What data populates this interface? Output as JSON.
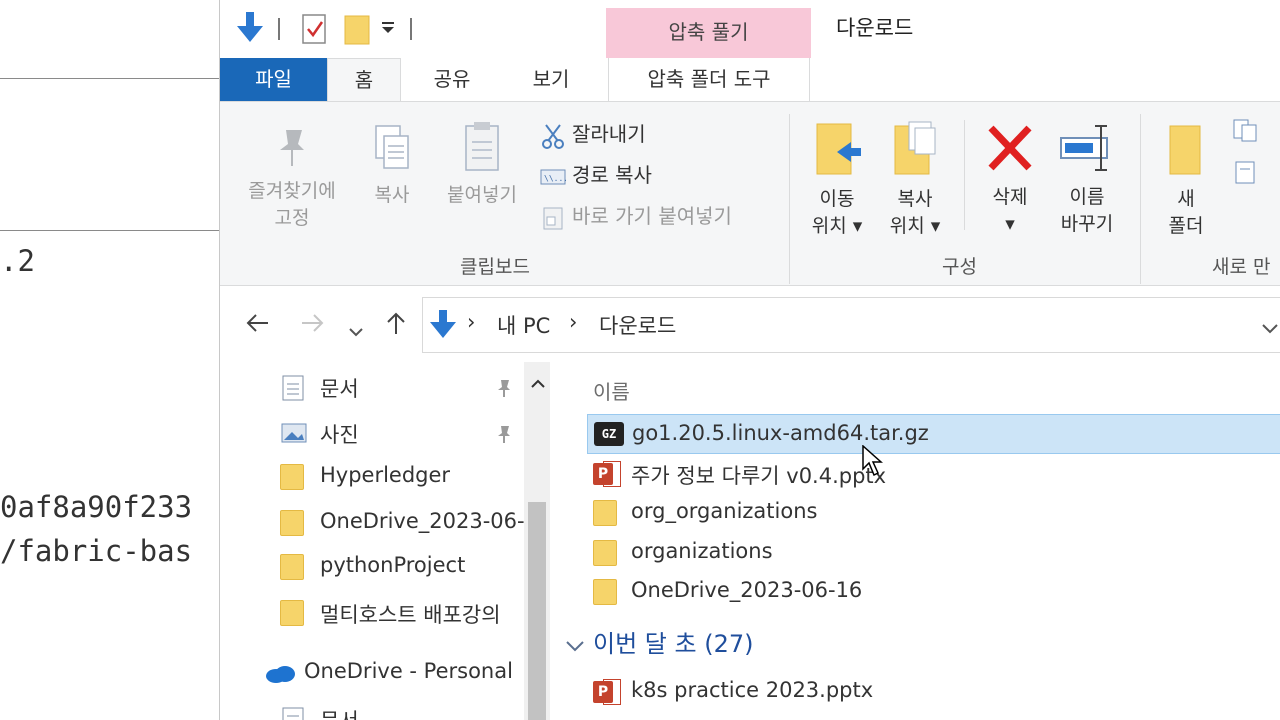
{
  "background_terminal": {
    "lines": [
      ".2",
      "0af8a90f233",
      "/fabric-bas"
    ]
  },
  "titlebar": {
    "contextual_tab_group": "압축 풀기",
    "window_title": "다운로드"
  },
  "tabs": {
    "file": "파일",
    "home": "홈",
    "share": "공유",
    "view": "보기",
    "compressed_tools": "압축 폴더 도구"
  },
  "ribbon": {
    "clipboard": {
      "pin_label": "즐겨찾기에\n고정",
      "copy_label": "복사",
      "paste_label": "붙여넣기",
      "cut_label": "잘라내기",
      "copy_path_label": "경로 복사",
      "paste_shortcut_label": "바로 가기 붙여넣기",
      "group_label": "클립보드"
    },
    "organize": {
      "move_to_label": "이동\n위치 ▾",
      "copy_to_label": "복사\n위치 ▾",
      "delete_label": "삭제\n▾",
      "rename_label": "이름\n바꾸기",
      "group_label": "구성"
    },
    "new": {
      "new_folder_label": "새\n폴더",
      "group_label": "새로 만"
    }
  },
  "address": {
    "crumbs": [
      "내 PC",
      "다운로드"
    ]
  },
  "navpane": {
    "items": [
      {
        "label": "문서",
        "icon": "document-icon",
        "pinned": true
      },
      {
        "label": "사진",
        "icon": "picture-icon",
        "pinned": true
      },
      {
        "label": "Hyperledger",
        "icon": "folder-icon"
      },
      {
        "label": "OneDrive_2023-06-",
        "icon": "folder-icon"
      },
      {
        "label": "pythonProject",
        "icon": "folder-icon"
      },
      {
        "label": "멀티호스트 배포강의",
        "icon": "folder-icon"
      },
      {
        "label": "OneDrive - Personal",
        "icon": "onedrive-cloud-icon"
      },
      {
        "label": "문서",
        "icon": "document-icon"
      }
    ]
  },
  "filelist": {
    "column_name": "이름",
    "files": [
      {
        "name": "go1.20.5.linux-amd64.tar.gz",
        "icon": "gz-archive-icon",
        "selected": true
      },
      {
        "name": "주가 정보 다루기 v0.4.pptx",
        "icon": "powerpoint-icon"
      },
      {
        "name": "org_organizations",
        "icon": "folder-icon"
      },
      {
        "name": "organizations",
        "icon": "folder-icon"
      },
      {
        "name": "OneDrive_2023-06-16",
        "icon": "folder-icon"
      }
    ],
    "group_header": "이번 달 초 (27)",
    "group_files": [
      {
        "name": "k8s practice 2023.pptx",
        "icon": "powerpoint-icon"
      }
    ]
  }
}
